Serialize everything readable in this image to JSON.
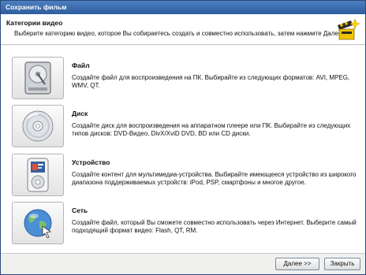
{
  "window": {
    "title": "Сохранить фильм"
  },
  "header": {
    "title": "Категории видео",
    "description": "Выберите категорию видео, которое Вы собираетесь создать и совместно использовать, затем нажмите Далее."
  },
  "categories": [
    {
      "title": "Файл",
      "description": "Создайте файл для воспроизведения на ПК. Выбирайте из следующих форматов: AVI, MPEG, WMV, QT.",
      "icon": "hard-drive-icon"
    },
    {
      "title": "Диск",
      "description": "Создайте диск для воспроизведения на аппаратном плеере или ПК. Выбирайте из следующих типов дисков: DVD-Видео, DivX/XviD DVD, BD или CD диски.",
      "icon": "disc-icon"
    },
    {
      "title": "Устройство",
      "description": "Создайте контент для мультимедиа-устройства. Выбирайте имеющееся устройство из широкого диапазона поддерживаемых устройств: iPod, PSP, смартфоны и многое другое.",
      "icon": "media-player-icon"
    },
    {
      "title": "Сеть",
      "description": "Создайте файл, который Вы сможете совместно использовать через Интернет. Выберите самый подходящий формат видео: Flash, QT, RM.",
      "icon": "globe-icon"
    }
  ],
  "footer": {
    "next_label": "Далее >>",
    "close_label": "Закрыть"
  }
}
